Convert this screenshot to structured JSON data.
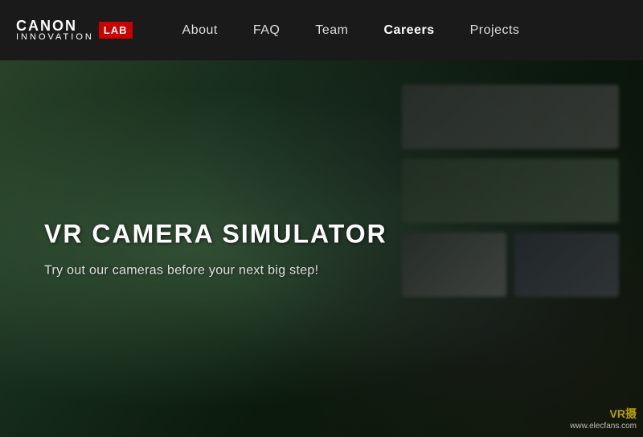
{
  "logo": {
    "canon": "CANON",
    "innovation": "INNOVATION",
    "lab": "LAB"
  },
  "nav": {
    "links": [
      {
        "label": "About",
        "active": false
      },
      {
        "label": "FAQ",
        "active": false
      },
      {
        "label": "Team",
        "active": false
      },
      {
        "label": "Careers",
        "active": true
      },
      {
        "label": "Projects",
        "active": false
      }
    ]
  },
  "hero": {
    "title": "VR CAMERA SIMULATOR",
    "subtitle": "Try out our cameras before your next big step!"
  },
  "watermark": {
    "site": "VR摄",
    "url": "www.elecfans.com"
  }
}
